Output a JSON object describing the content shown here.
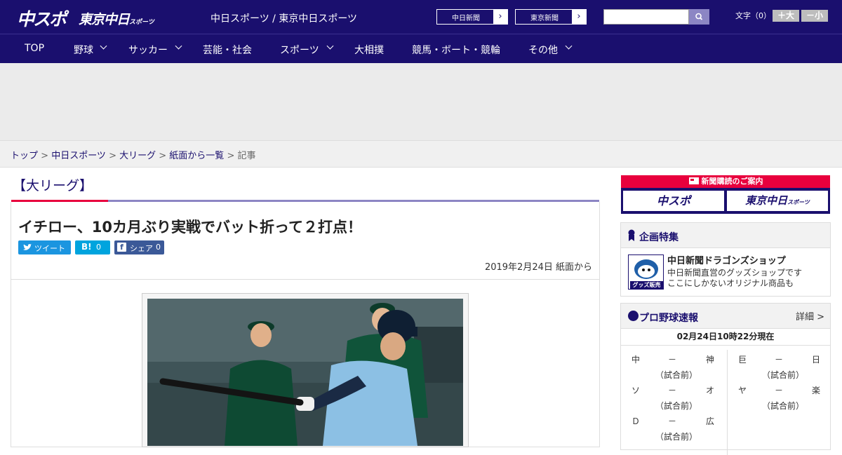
{
  "header": {
    "logo_main": "中スポ",
    "logo_tokyo": "東京中日",
    "logo_tokyo_sub": "スポーツ",
    "site_names": "中日スポーツ / 東京中日スポーツ",
    "links": [
      {
        "label": "中日新聞",
        "arrow": "›"
      },
      {
        "label": "東京新聞",
        "arrow": "›"
      }
    ],
    "search": {
      "placeholder": "",
      "value": ""
    },
    "font_size": {
      "label": "文字（0）",
      "larger": "＋大",
      "smaller": "－小"
    }
  },
  "nav": {
    "items": [
      {
        "label": "TOP",
        "dropdown": false
      },
      {
        "label": "野球",
        "dropdown": true
      },
      {
        "label": "サッカー",
        "dropdown": true
      },
      {
        "label": "芸能・社会",
        "dropdown": false
      },
      {
        "label": "スポーツ",
        "dropdown": true
      },
      {
        "label": "大相撲",
        "dropdown": false
      },
      {
        "label": "競馬・ボート・競輪",
        "dropdown": false
      },
      {
        "label": "その他",
        "dropdown": true
      }
    ]
  },
  "breadcrumb": {
    "items": [
      "トップ",
      "中日スポーツ",
      "大リーグ",
      "紙面から一覧"
    ],
    "separator": " > ",
    "current": "記事"
  },
  "article": {
    "category": "【大リーグ】",
    "headline": "イチロー、10カ月ぶり実戦でバット折って２打点！",
    "share": {
      "tweet": "ツイート",
      "hatena_icon": "B!",
      "hatena_count": "0",
      "facebook_label": "シェア",
      "facebook_count": "0"
    },
    "date": "2019年2月24日 紙面から"
  },
  "sidebar": {
    "subscribe": {
      "title": "新聞購読のご案内",
      "logo_chuspo": "中スポ",
      "logo_tokyo": "東京中日",
      "logo_tokyo_sub": "スポーツ"
    },
    "special": {
      "title": "企画特集",
      "shop_name": "中日新聞ドラゴンズショップ",
      "shop_desc_1": "中日新聞直営のグッズショップです",
      "shop_desc_2": "ここにしかないオリジナル商品も",
      "thumb_text": "グッズ販売中"
    },
    "scores": {
      "title": "プロ野球速報",
      "detail": "詳細 >",
      "as_of": "02月24日10時22分現在",
      "games": [
        {
          "home": "中",
          "away": "神",
          "sep": "－",
          "status": "（試合前）"
        },
        {
          "home": "巨",
          "away": "日",
          "sep": "－",
          "status": "（試合前）"
        },
        {
          "home": "ソ",
          "away": "オ",
          "sep": "－",
          "status": "（試合前）"
        },
        {
          "home": "ヤ",
          "away": "楽",
          "sep": "－",
          "status": "（試合前）"
        },
        {
          "home": "Ｄ",
          "away": "広",
          "sep": "－",
          "status": "（試合前）"
        }
      ]
    }
  },
  "colors": {
    "brand_navy": "#1a0f6e",
    "accent_red": "#e8003d",
    "accent_lavender": "#8c86c4",
    "twitter_blue": "#1b95e0",
    "facebook_blue": "#3b5998",
    "hatena_blue": "#00a4de"
  }
}
